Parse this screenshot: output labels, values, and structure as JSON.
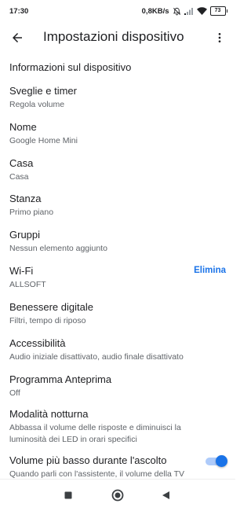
{
  "status_bar": {
    "time": "17:30",
    "network_speed": "0,8KB/s",
    "battery_level": "73",
    "icons": [
      "mute-icon",
      "signal-icon",
      "wifi-icon",
      "battery-icon"
    ]
  },
  "app_bar": {
    "title": "Impostazioni dispositivo",
    "back_icon": "arrow-back-icon",
    "more_icon": "more-vert-icon"
  },
  "section": {
    "header": "Informazioni sul dispositivo"
  },
  "settings": [
    {
      "title": "Sveglie e timer",
      "subtitle": "Regola volume"
    },
    {
      "title": "Nome",
      "subtitle": "Google Home Mini"
    },
    {
      "title": "Casa",
      "subtitle": "Casa"
    },
    {
      "title": "Stanza",
      "subtitle": "Primo piano"
    },
    {
      "title": "Gruppi",
      "subtitle": "Nessun elemento aggiunto"
    },
    {
      "title": "Wi-Fi",
      "subtitle": "ALLSOFT",
      "action": "Elimina"
    },
    {
      "title": "Benessere digitale",
      "subtitle": "Filtri, tempo di riposo"
    },
    {
      "title": "Accessibilità",
      "subtitle": "Audio iniziale disattivato, audio finale disattivato"
    },
    {
      "title": "Programma Anteprima",
      "subtitle": "Off"
    },
    {
      "title": "Modalità notturna",
      "subtitle_line1": "Abbassa il volume delle risposte e diminuisci la",
      "subtitle_line2": "luminosità dei LED in orari specifici"
    },
    {
      "title": "Volume più basso durante l'ascolto",
      "subtitle": "Quando parli con l'assistente, il volume della TV",
      "toggle_on": true
    }
  ],
  "colors": {
    "accent": "#1a73e8",
    "text_primary": "#202124",
    "text_secondary": "#5f6368"
  },
  "nav_bar": {
    "icons": [
      "recents-square-icon",
      "home-circle-icon",
      "back-triangle-icon"
    ]
  }
}
